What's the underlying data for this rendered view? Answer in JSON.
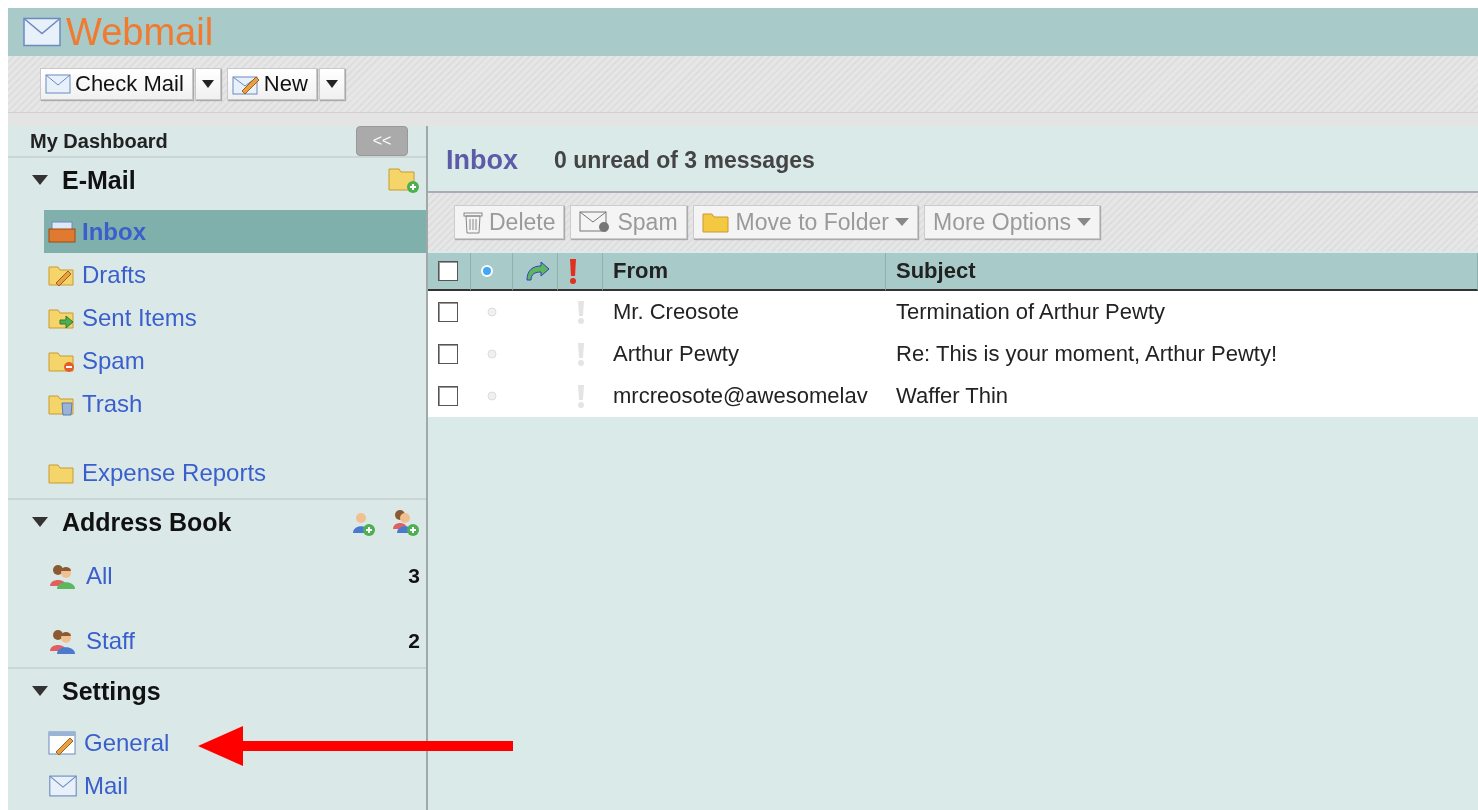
{
  "app": {
    "title": "Webmail"
  },
  "toolbar": [
    {
      "label": "Check Mail",
      "dropdown": true
    },
    {
      "label": "New",
      "dropdown": true
    }
  ],
  "sidebar": {
    "title": "My Dashboard",
    "collapse_label": "<<",
    "sections": [
      {
        "kind": "email",
        "title": "E-Mail",
        "expanded": true,
        "items": [
          {
            "label": "Inbox",
            "selected": true
          },
          {
            "label": "Drafts",
            "selected": false
          },
          {
            "label": "Sent Items",
            "selected": false
          },
          {
            "label": "Spam",
            "selected": false
          },
          {
            "label": "Trash",
            "selected": false
          }
        ],
        "custom_folders": [
          {
            "label": "Expense Reports",
            "selected": false
          }
        ]
      },
      {
        "kind": "contacts",
        "title": "Address Book",
        "expanded": true,
        "items": [
          {
            "label": "All",
            "count": "3",
            "selected": false
          },
          {
            "label": "Staff",
            "count": "2",
            "selected": false
          }
        ]
      },
      {
        "kind": "settings",
        "title": "Settings",
        "expanded": true,
        "items": [
          {
            "label": "General",
            "selected": false
          },
          {
            "label": "Mail",
            "selected": false
          }
        ]
      }
    ]
  },
  "main": {
    "folder": "Inbox",
    "summary": "0 unread of 3 messages",
    "actions": [
      {
        "label": "Delete",
        "disabled": true,
        "dropdown": false
      },
      {
        "label": "Spam",
        "disabled": true,
        "dropdown": false
      },
      {
        "label": "Move to Folder",
        "disabled": true,
        "dropdown": true
      },
      {
        "label": "More Options",
        "disabled": true,
        "dropdown": true
      }
    ],
    "columns": [
      "From",
      "Subject"
    ],
    "select_all": {
      "checked": false
    },
    "messages": [
      {
        "from": "Mr. Creosote",
        "subject": "Termination of Arthur Pewty",
        "checked": false,
        "unread": false,
        "flagged": false
      },
      {
        "from": "Arthur Pewty",
        "subject": "Re: This is your moment, Arthur Pewty!",
        "checked": false,
        "unread": false,
        "flagged": false
      },
      {
        "from": "mrcreosote@awesomelav",
        "subject": "Waffer Thin",
        "checked": false,
        "unread": false,
        "flagged": false
      }
    ]
  }
}
